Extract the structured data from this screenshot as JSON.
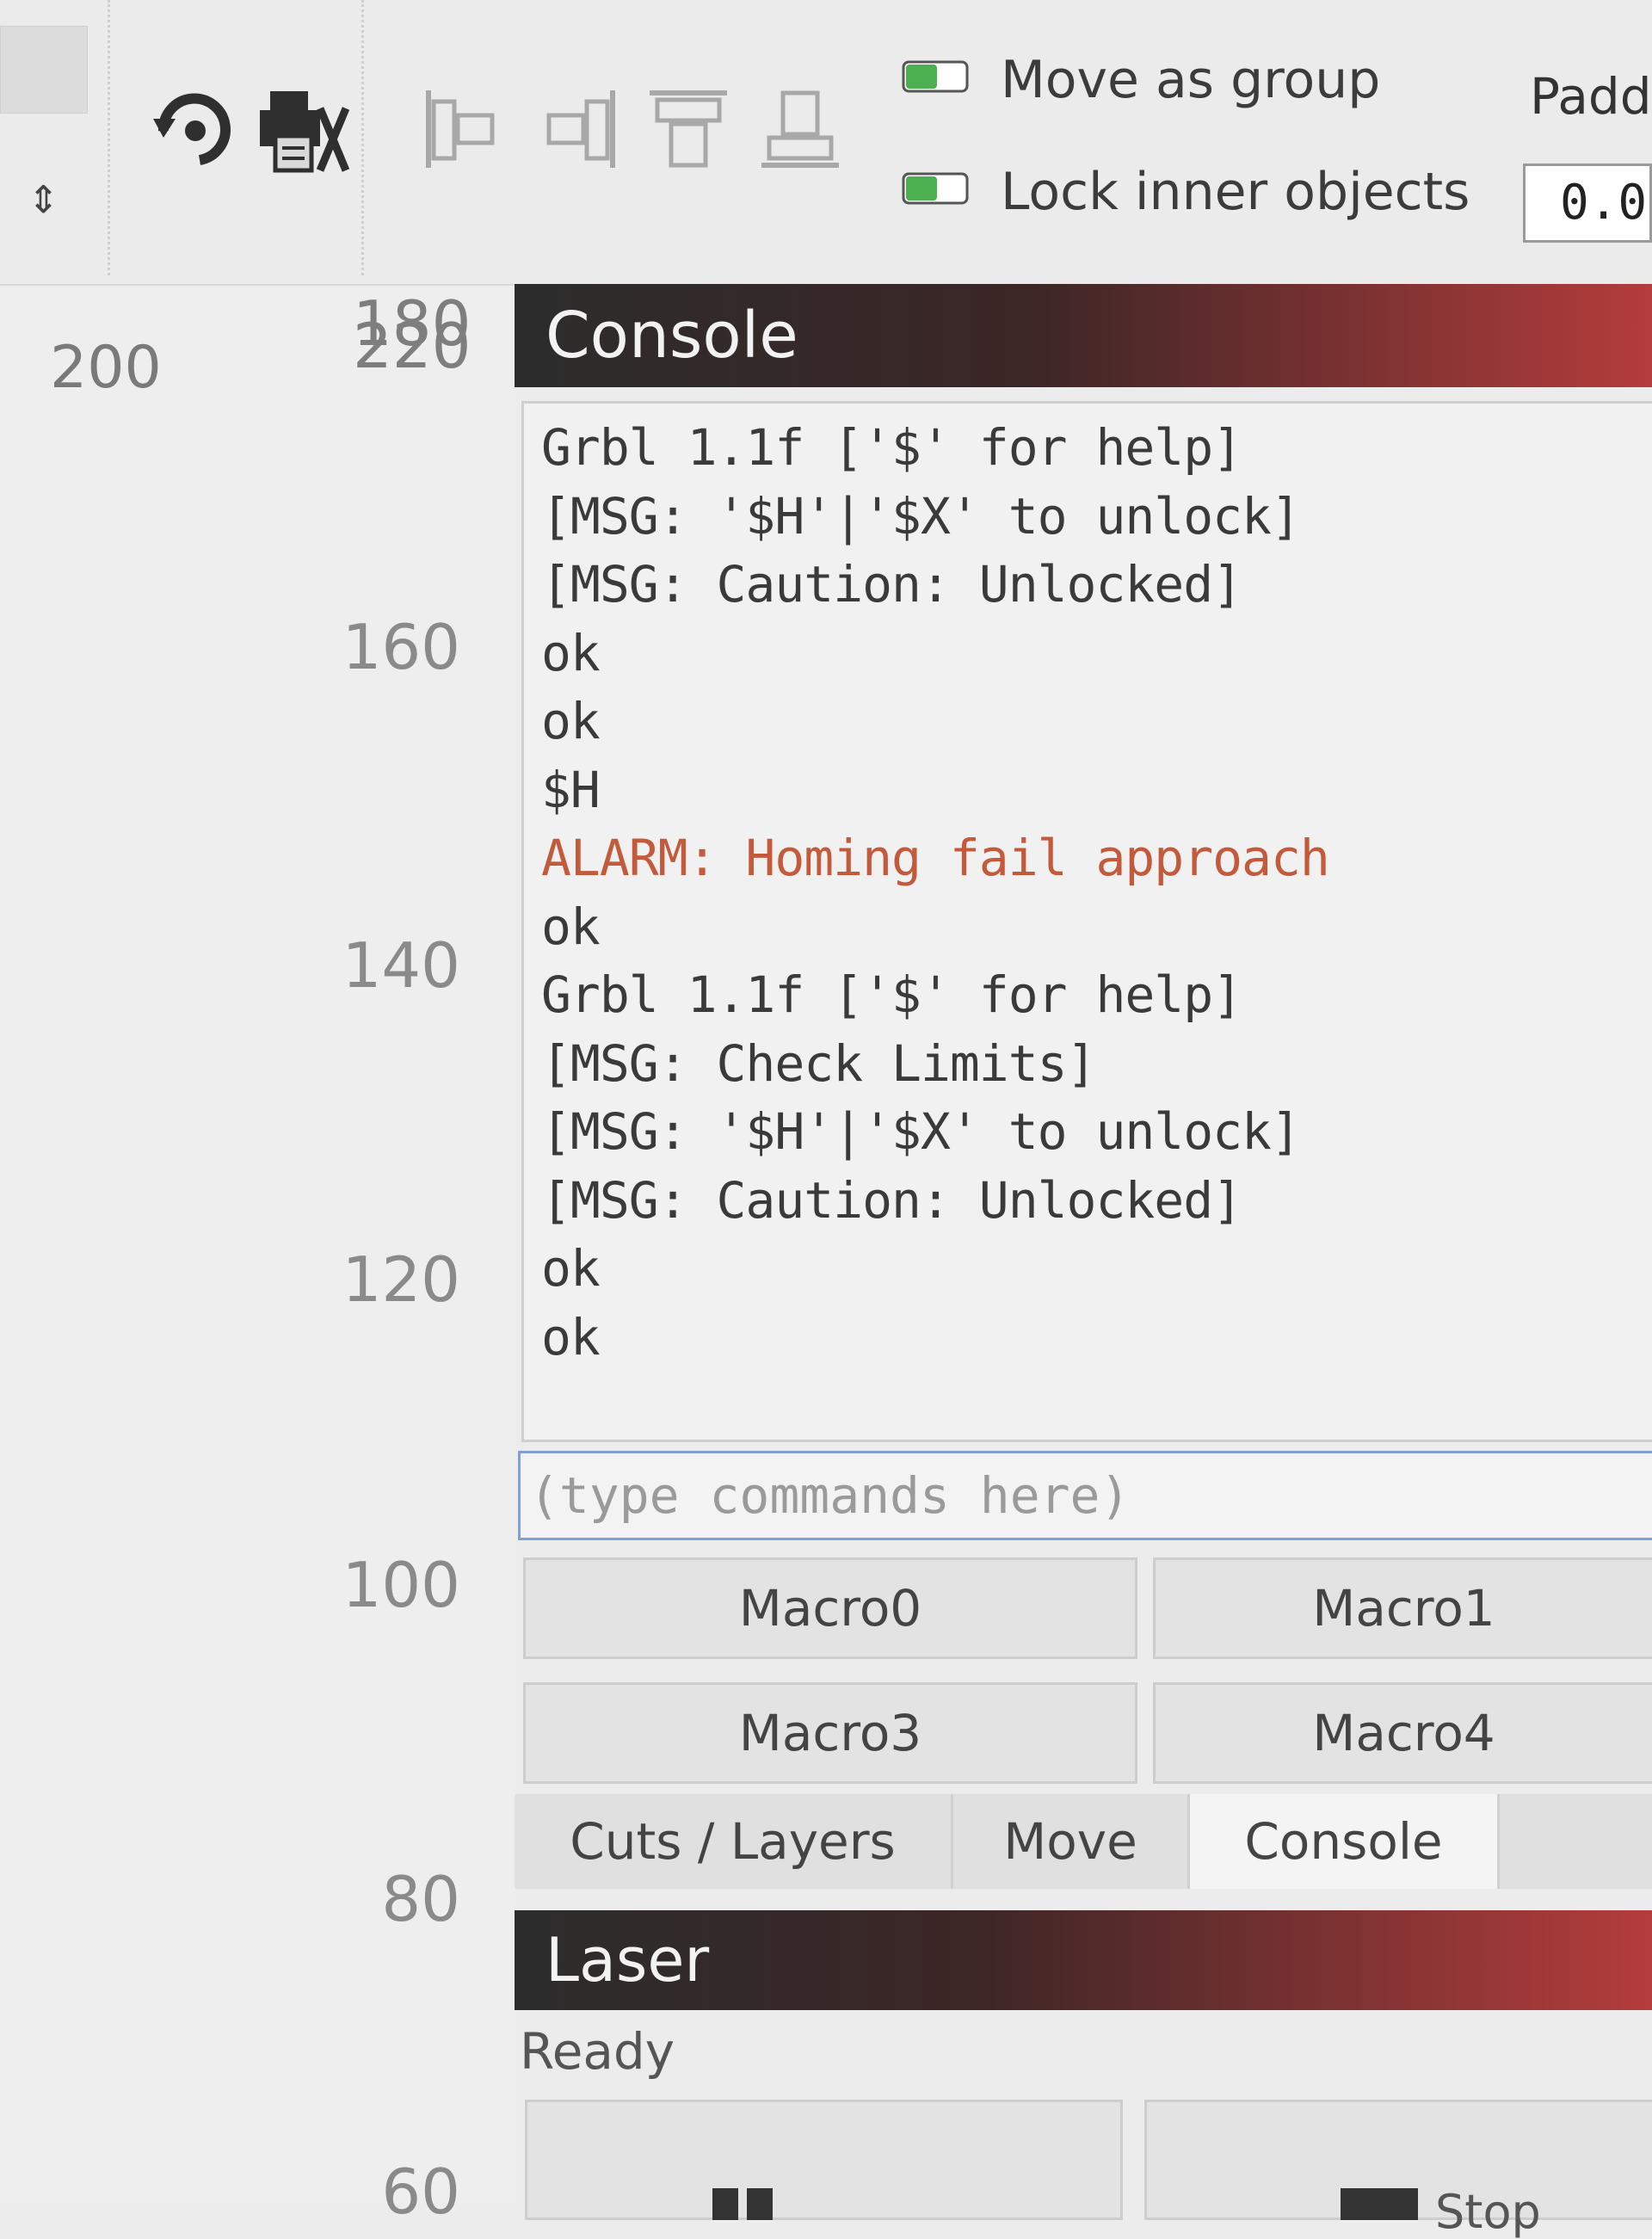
{
  "toolbar": {
    "move_as_group_label": "Move as group",
    "lock_inner_objects_label": "Lock inner objects",
    "padding_label": "Paddi",
    "padding_value": "0.0",
    "checkbox_color": "#4caf50",
    "icons": [
      "rotate-icon",
      "print-cut-icon",
      "align-left-icon",
      "align-right-icon",
      "align-top-icon",
      "align-bottom-icon"
    ]
  },
  "ruler": {
    "x_label": "200",
    "y_overlap_a": "180",
    "y_overlap_b": "220",
    "y_labels": [
      "160",
      "140",
      "120",
      "100",
      "80",
      "60"
    ]
  },
  "console": {
    "title": "Console",
    "lines": [
      "Grbl 1.1f ['$' for help]",
      "[MSG: '$H'|'$X' to unlock]",
      "[MSG: Caution: Unlocked]",
      "ok",
      "ok",
      "$H",
      "ALARM: Homing fail approach",
      "ok",
      "Grbl 1.1f ['$' for help]",
      "[MSG: Check Limits]",
      "[MSG: '$H'|'$X' to unlock]",
      "[MSG: Caution: Unlocked]",
      "ok",
      "ok"
    ],
    "alarm_color": "#c45a3c",
    "command_placeholder": "(type commands here)",
    "macros": [
      "Macro0",
      "Macro1",
      "Macro3",
      "Macro4"
    ]
  },
  "tabs": [
    "Cuts / Layers",
    "Move",
    "Console"
  ],
  "active_tab": "Console",
  "laser": {
    "title": "Laser",
    "status": "Ready",
    "stop_label": "Stop"
  },
  "colors": {
    "panel_header_dark": "#2c2c2c",
    "panel_header_red": "#b43c3c"
  }
}
